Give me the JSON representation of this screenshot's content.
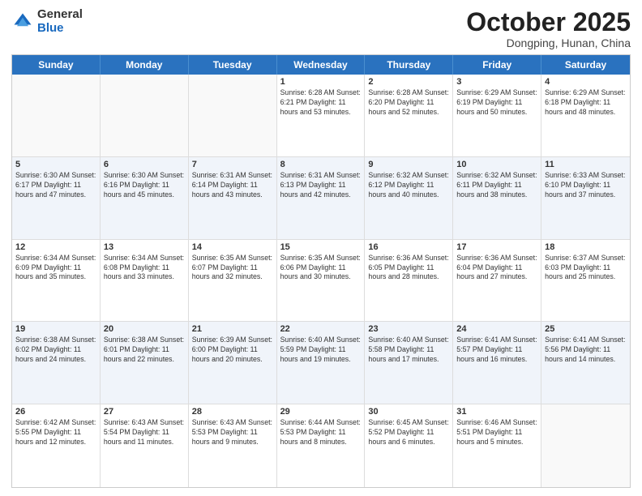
{
  "header": {
    "logo_general": "General",
    "logo_blue": "Blue",
    "month_title": "October 2025",
    "location": "Dongping, Hunan, China"
  },
  "days_of_week": [
    "Sunday",
    "Monday",
    "Tuesday",
    "Wednesday",
    "Thursday",
    "Friday",
    "Saturday"
  ],
  "weeks": [
    [
      {
        "num": "",
        "info": "",
        "empty": true
      },
      {
        "num": "",
        "info": "",
        "empty": true
      },
      {
        "num": "",
        "info": "",
        "empty": true
      },
      {
        "num": "1",
        "info": "Sunrise: 6:28 AM\nSunset: 6:21 PM\nDaylight: 11 hours\nand 53 minutes.",
        "empty": false
      },
      {
        "num": "2",
        "info": "Sunrise: 6:28 AM\nSunset: 6:20 PM\nDaylight: 11 hours\nand 52 minutes.",
        "empty": false
      },
      {
        "num": "3",
        "info": "Sunrise: 6:29 AM\nSunset: 6:19 PM\nDaylight: 11 hours\nand 50 minutes.",
        "empty": false
      },
      {
        "num": "4",
        "info": "Sunrise: 6:29 AM\nSunset: 6:18 PM\nDaylight: 11 hours\nand 48 minutes.",
        "empty": false
      }
    ],
    [
      {
        "num": "5",
        "info": "Sunrise: 6:30 AM\nSunset: 6:17 PM\nDaylight: 11 hours\nand 47 minutes.",
        "empty": false
      },
      {
        "num": "6",
        "info": "Sunrise: 6:30 AM\nSunset: 6:16 PM\nDaylight: 11 hours\nand 45 minutes.",
        "empty": false
      },
      {
        "num": "7",
        "info": "Sunrise: 6:31 AM\nSunset: 6:14 PM\nDaylight: 11 hours\nand 43 minutes.",
        "empty": false
      },
      {
        "num": "8",
        "info": "Sunrise: 6:31 AM\nSunset: 6:13 PM\nDaylight: 11 hours\nand 42 minutes.",
        "empty": false
      },
      {
        "num": "9",
        "info": "Sunrise: 6:32 AM\nSunset: 6:12 PM\nDaylight: 11 hours\nand 40 minutes.",
        "empty": false
      },
      {
        "num": "10",
        "info": "Sunrise: 6:32 AM\nSunset: 6:11 PM\nDaylight: 11 hours\nand 38 minutes.",
        "empty": false
      },
      {
        "num": "11",
        "info": "Sunrise: 6:33 AM\nSunset: 6:10 PM\nDaylight: 11 hours\nand 37 minutes.",
        "empty": false
      }
    ],
    [
      {
        "num": "12",
        "info": "Sunrise: 6:34 AM\nSunset: 6:09 PM\nDaylight: 11 hours\nand 35 minutes.",
        "empty": false
      },
      {
        "num": "13",
        "info": "Sunrise: 6:34 AM\nSunset: 6:08 PM\nDaylight: 11 hours\nand 33 minutes.",
        "empty": false
      },
      {
        "num": "14",
        "info": "Sunrise: 6:35 AM\nSunset: 6:07 PM\nDaylight: 11 hours\nand 32 minutes.",
        "empty": false
      },
      {
        "num": "15",
        "info": "Sunrise: 6:35 AM\nSunset: 6:06 PM\nDaylight: 11 hours\nand 30 minutes.",
        "empty": false
      },
      {
        "num": "16",
        "info": "Sunrise: 6:36 AM\nSunset: 6:05 PM\nDaylight: 11 hours\nand 28 minutes.",
        "empty": false
      },
      {
        "num": "17",
        "info": "Sunrise: 6:36 AM\nSunset: 6:04 PM\nDaylight: 11 hours\nand 27 minutes.",
        "empty": false
      },
      {
        "num": "18",
        "info": "Sunrise: 6:37 AM\nSunset: 6:03 PM\nDaylight: 11 hours\nand 25 minutes.",
        "empty": false
      }
    ],
    [
      {
        "num": "19",
        "info": "Sunrise: 6:38 AM\nSunset: 6:02 PM\nDaylight: 11 hours\nand 24 minutes.",
        "empty": false
      },
      {
        "num": "20",
        "info": "Sunrise: 6:38 AM\nSunset: 6:01 PM\nDaylight: 11 hours\nand 22 minutes.",
        "empty": false
      },
      {
        "num": "21",
        "info": "Sunrise: 6:39 AM\nSunset: 6:00 PM\nDaylight: 11 hours\nand 20 minutes.",
        "empty": false
      },
      {
        "num": "22",
        "info": "Sunrise: 6:40 AM\nSunset: 5:59 PM\nDaylight: 11 hours\nand 19 minutes.",
        "empty": false
      },
      {
        "num": "23",
        "info": "Sunrise: 6:40 AM\nSunset: 5:58 PM\nDaylight: 11 hours\nand 17 minutes.",
        "empty": false
      },
      {
        "num": "24",
        "info": "Sunrise: 6:41 AM\nSunset: 5:57 PM\nDaylight: 11 hours\nand 16 minutes.",
        "empty": false
      },
      {
        "num": "25",
        "info": "Sunrise: 6:41 AM\nSunset: 5:56 PM\nDaylight: 11 hours\nand 14 minutes.",
        "empty": false
      }
    ],
    [
      {
        "num": "26",
        "info": "Sunrise: 6:42 AM\nSunset: 5:55 PM\nDaylight: 11 hours\nand 12 minutes.",
        "empty": false
      },
      {
        "num": "27",
        "info": "Sunrise: 6:43 AM\nSunset: 5:54 PM\nDaylight: 11 hours\nand 11 minutes.",
        "empty": false
      },
      {
        "num": "28",
        "info": "Sunrise: 6:43 AM\nSunset: 5:53 PM\nDaylight: 11 hours\nand 9 minutes.",
        "empty": false
      },
      {
        "num": "29",
        "info": "Sunrise: 6:44 AM\nSunset: 5:53 PM\nDaylight: 11 hours\nand 8 minutes.",
        "empty": false
      },
      {
        "num": "30",
        "info": "Sunrise: 6:45 AM\nSunset: 5:52 PM\nDaylight: 11 hours\nand 6 minutes.",
        "empty": false
      },
      {
        "num": "31",
        "info": "Sunrise: 6:46 AM\nSunset: 5:51 PM\nDaylight: 11 hours\nand 5 minutes.",
        "empty": false
      },
      {
        "num": "",
        "info": "",
        "empty": true
      }
    ]
  ]
}
